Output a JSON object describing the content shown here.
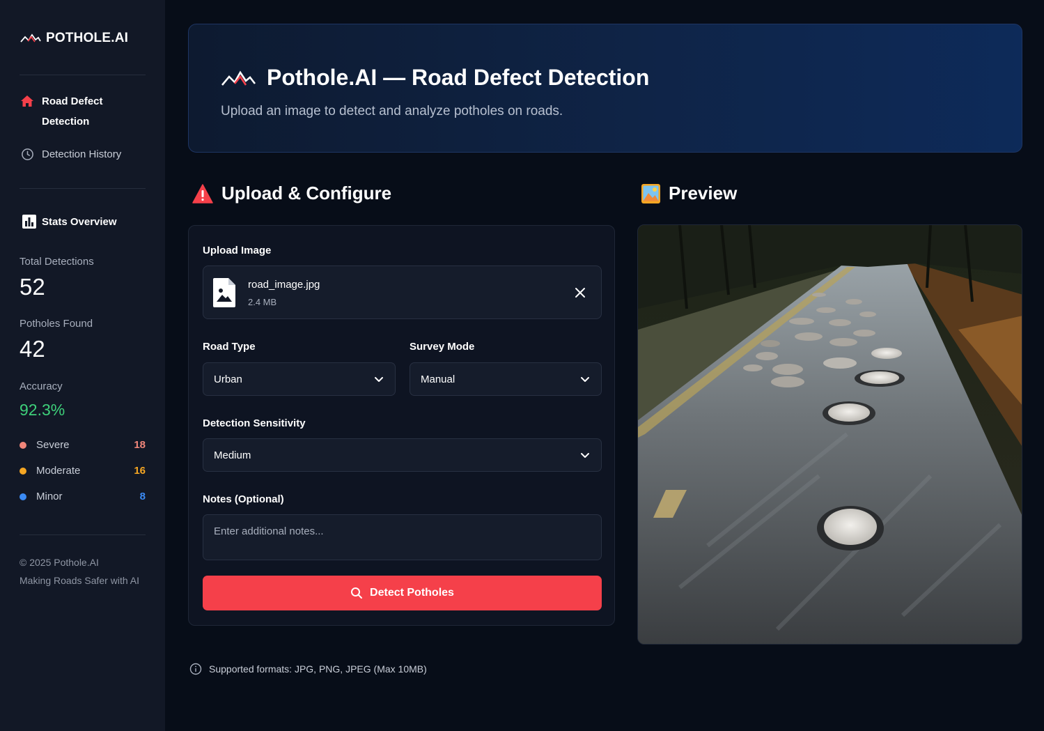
{
  "brand": {
    "name": "POTHOLE.AI"
  },
  "nav": {
    "items": [
      {
        "label_line1": "Road Defect",
        "label_line2": "Detection"
      },
      {
        "label": "Detection History"
      }
    ]
  },
  "stats": {
    "title": "Stats Overview",
    "total_label": "Total Detections",
    "total_value": "52",
    "found_label": "Potholes Found",
    "found_value": "42",
    "accuracy_label": "Accuracy",
    "accuracy_value": "92.3%",
    "severity": [
      {
        "label": "Severe",
        "count": "18",
        "color": "#f0867a"
      },
      {
        "label": "Moderate",
        "count": "16",
        "color": "#f5a623"
      },
      {
        "label": "Minor",
        "count": "8",
        "color": "#3b8bf5"
      }
    ]
  },
  "footer": {
    "copyright": "© 2025 Pothole.AI",
    "tagline": "Making Roads Safer with AI"
  },
  "hero": {
    "title": "Pothole.AI — Road Defect Detection",
    "subtitle": "Upload an image to detect and analyze potholes on roads."
  },
  "upload": {
    "section_title": "Upload & Configure",
    "image_label": "Upload Image",
    "file_name": "road_image.jpg",
    "file_size": "2.4 MB",
    "road_type_label": "Road Type",
    "road_type_value": "Urban",
    "survey_mode_label": "Survey Mode",
    "survey_mode_value": "Manual",
    "sensitivity_label": "Detection Sensitivity",
    "sensitivity_value": "Medium",
    "notes_label": "Notes (Optional)",
    "notes_placeholder": "Enter additional notes...",
    "detect_button": "Detect Potholes",
    "supported_note": "Supported formats: JPG, PNG, JPEG (Max 10MB)"
  },
  "preview": {
    "section_title": "Preview"
  },
  "colors": {
    "accent": "#f5404a",
    "success": "#3ed07a",
    "sidebar": "#121826",
    "background": "#070d18"
  }
}
